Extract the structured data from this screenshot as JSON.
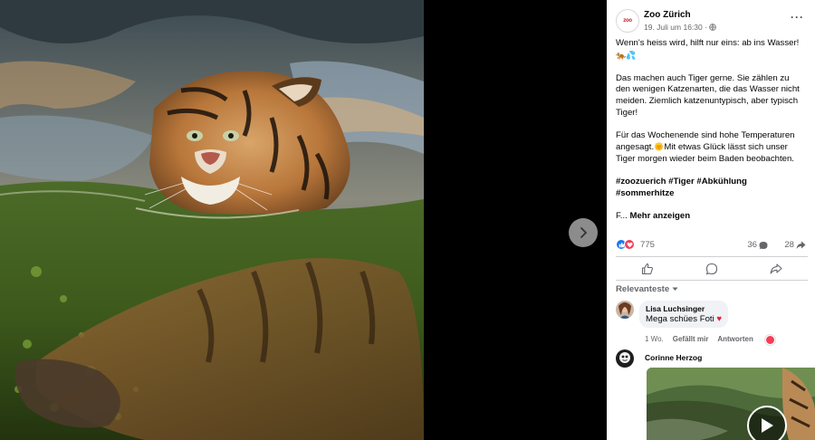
{
  "colors": {
    "brand": "#1877f2",
    "love": "#f33e58",
    "panel_bg": "#ffffff",
    "muted_text": "#65676b"
  },
  "post": {
    "author": "Zoo Zürich",
    "avatar_logo": "zoo",
    "timestamp": "19. Juli um 16:30 ·",
    "privacy_icon": "globe-icon",
    "paragraphs": [
      "Wenn's heiss wird, hilft nur eins: ab ins Wasser!",
      "Das machen auch Tiger gerne. Sie zählen zu den wenigen Katzenarten, die das Wasser nicht meiden. Ziemlich katzenuntypisch, aber typisch Tiger!",
      "Für das Wochenende sind hohe Temperaturen angesagt.",
      "Mit etwas Glück lässt sich unser Tiger morgen wieder beim Baden beobachten."
    ],
    "emoji_line": "🐅💦",
    "sun_emoji": "🌞",
    "hashtags_line1": "#zoozuerich #Tiger #Abkühlung",
    "hashtags_line2": "#sommerhitze",
    "see_more_prefix": "F...",
    "see_more_label": "Mehr anzeigen"
  },
  "reactions": {
    "count": "775",
    "comments": "36",
    "shares": "28"
  },
  "comments_sort_label": "Relevanteste",
  "comments": [
    {
      "author": "Lisa Luchsinger",
      "text": "Mega schües Foti",
      "heart": "♥",
      "age": "1 Wo.",
      "like_label": "Gefällt mir",
      "reply_label": "Antworten"
    },
    {
      "author": "Corinne Herzog"
    }
  ]
}
